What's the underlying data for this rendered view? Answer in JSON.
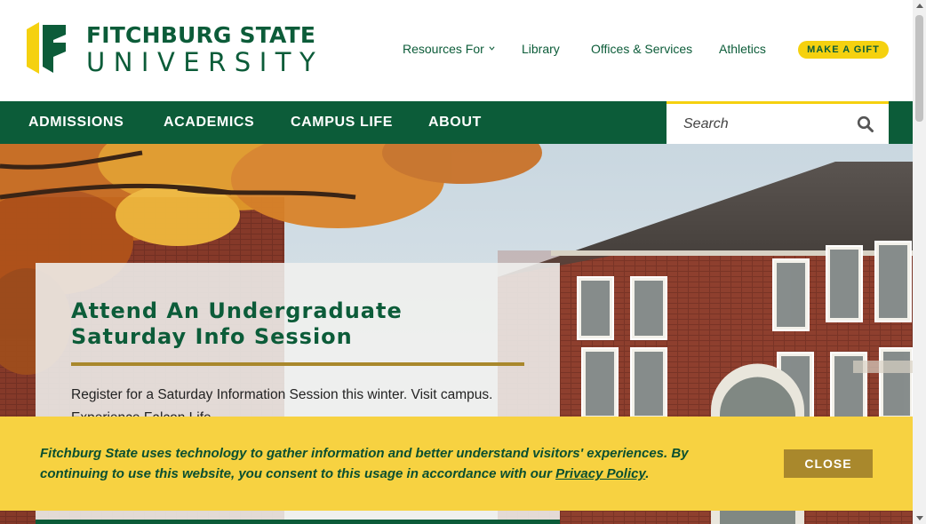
{
  "brand": {
    "name_line1": "FITCHBURG STATE",
    "name_line2": "UNIVERSITY",
    "colors": {
      "green": "#0c5c39",
      "gold": "#f5d10f",
      "bronze": "#a9882c"
    }
  },
  "utility_nav": {
    "resources": "Resources For",
    "library": "Library",
    "offices": "Offices & Services",
    "athletics": "Athletics",
    "gift": "MAKE A GIFT"
  },
  "main_nav": {
    "items": [
      {
        "label": "ADMISSIONS"
      },
      {
        "label": "ACADEMICS"
      },
      {
        "label": "CAMPUS LIFE"
      },
      {
        "label": "ABOUT"
      }
    ]
  },
  "search": {
    "placeholder": "Search",
    "icon": "search-icon"
  },
  "hero": {
    "title": "Attend An Undergraduate Saturday Info Session",
    "text": "Register for a Saturday Information Session this winter. Visit campus. Experience Falcon Life."
  },
  "cookie": {
    "text_before": "Fitchburg State uses technology to gather information and better understand visitors' experiences. By continuing to use this website, you consent to this usage in accordance with our ",
    "link": "Privacy Policy",
    "text_after": ".",
    "close": "CLOSE"
  }
}
